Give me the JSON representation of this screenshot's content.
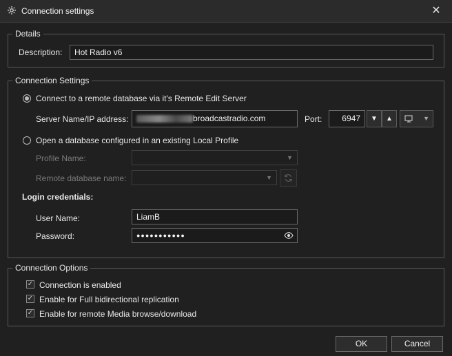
{
  "window": {
    "title": "Connection settings",
    "close_glyph": "✕",
    "icon": "gear-icon"
  },
  "details": {
    "legend": "Details",
    "description_label": "Description:",
    "description_value": "Hot Radio v6"
  },
  "connection_settings": {
    "legend": "Connection Settings",
    "remote_option_label": "Connect to a remote database via it's Remote Edit Server",
    "remote_selected": true,
    "server_label": "Server Name/IP address:",
    "server_value_visible": "broadcastradio.com",
    "port_label": "Port:",
    "port_value": "6947",
    "port_down_glyph": "▼",
    "port_up_glyph": "▲",
    "local_option_label": "Open a database configured in an existing Local Profile",
    "profile_name_label": "Profile Name:",
    "remote_db_label": "Remote database name:",
    "login_heading": "Login credentials:",
    "username_label": "User Name:",
    "username_value": "LiamB",
    "password_label": "Password:",
    "password_value": "●●●●●●●●●●●"
  },
  "connection_options": {
    "legend": "Connection Options",
    "options": [
      {
        "label": "Connection is enabled",
        "checked": true
      },
      {
        "label": "Enable for Full bidirectional replication",
        "checked": true
      },
      {
        "label": "Enable for remote Media browse/download",
        "checked": true
      }
    ]
  },
  "footer": {
    "ok_label": "OK",
    "cancel_label": "Cancel"
  }
}
